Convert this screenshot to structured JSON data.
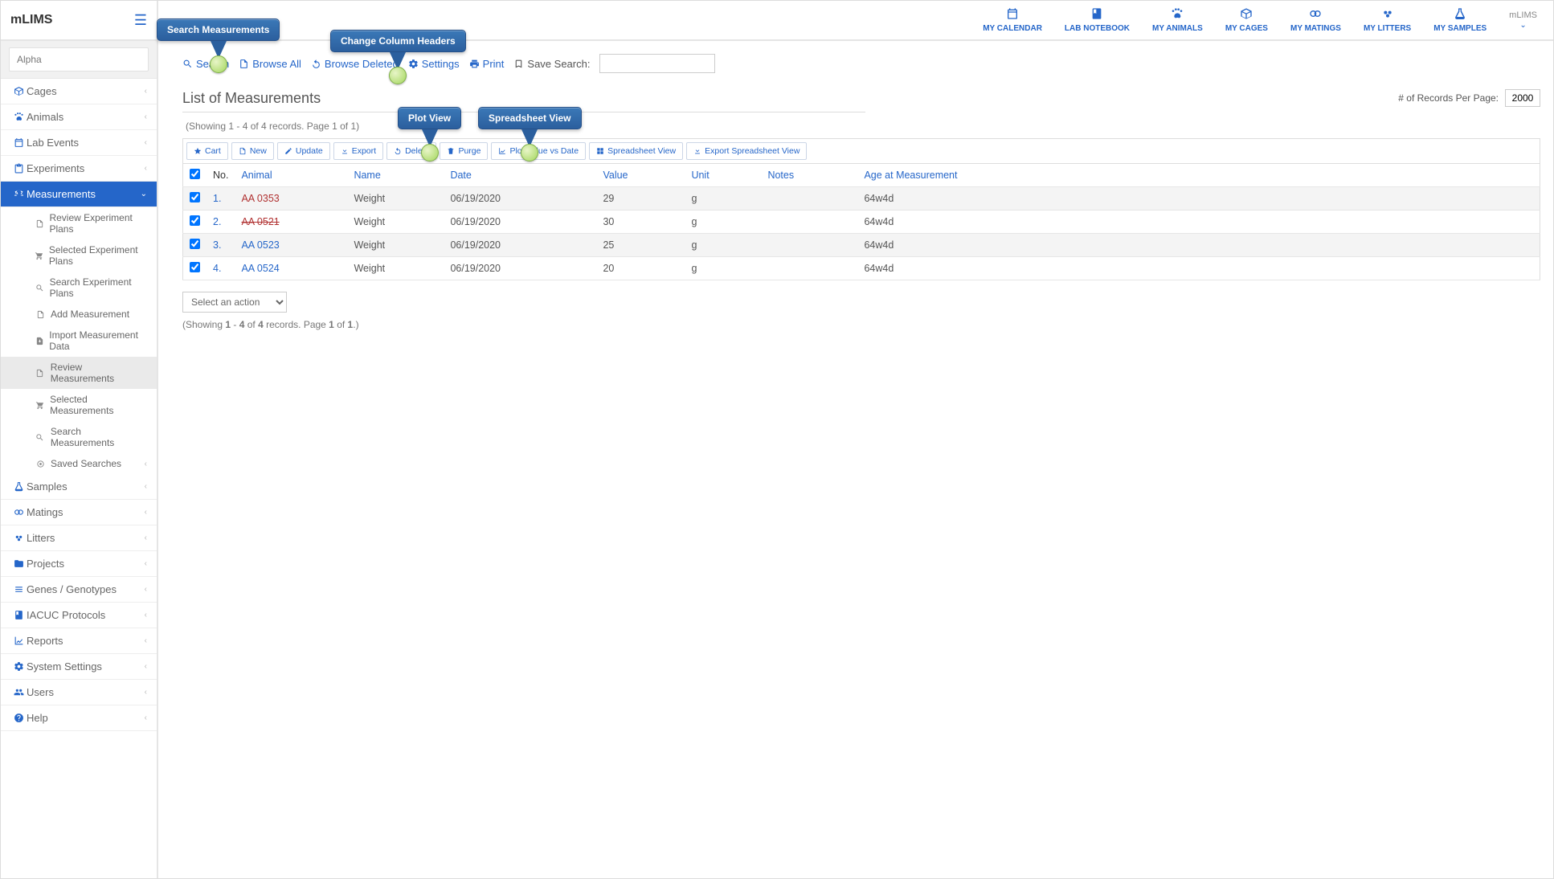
{
  "brand": "mLIMS",
  "search_value": "Alpha",
  "profile_label": "mLIMS",
  "quicknav": [
    {
      "label": "MY CALENDAR",
      "icon": "calendar"
    },
    {
      "label": "LAB NOTEBOOK",
      "icon": "book"
    },
    {
      "label": "MY ANIMALS",
      "icon": "paw"
    },
    {
      "label": "MY CAGES",
      "icon": "cube"
    },
    {
      "label": "MY MATINGS",
      "icon": "matings"
    },
    {
      "label": "MY LITTERS",
      "icon": "litters"
    },
    {
      "label": "MY SAMPLES",
      "icon": "flask"
    }
  ],
  "nav": {
    "items": [
      {
        "label": "Cages",
        "icon": "cube"
      },
      {
        "label": "Animals",
        "icon": "paw"
      },
      {
        "label": "Lab Events",
        "icon": "calendar"
      },
      {
        "label": "Experiments",
        "icon": "clipboard"
      },
      {
        "label": "Measurements",
        "icon": "scale",
        "active": true
      },
      {
        "label": "Samples",
        "icon": "flask"
      },
      {
        "label": "Matings",
        "icon": "matings"
      },
      {
        "label": "Litters",
        "icon": "litters"
      },
      {
        "label": "Projects",
        "icon": "folder"
      },
      {
        "label": "Genes / Genotypes",
        "icon": "list"
      },
      {
        "label": "IACUC Protocols",
        "icon": "book"
      },
      {
        "label": "Reports",
        "icon": "chart"
      },
      {
        "label": "System Settings",
        "icon": "gear"
      },
      {
        "label": "Users",
        "icon": "users"
      },
      {
        "label": "Help",
        "icon": "help"
      }
    ],
    "sub": [
      {
        "label": "Review Experiment Plans",
        "icon": "doc"
      },
      {
        "label": "Selected Experiment Plans",
        "icon": "cart"
      },
      {
        "label": "Search Experiment Plans",
        "icon": "search"
      },
      {
        "label": "Add Measurement",
        "icon": "doc"
      },
      {
        "label": "Import Measurement Data",
        "icon": "import"
      },
      {
        "label": "Review Measurements",
        "icon": "doc",
        "selected": true
      },
      {
        "label": "Selected Measurements",
        "icon": "cart"
      },
      {
        "label": "Search Measurements",
        "icon": "search"
      },
      {
        "label": "Saved Searches",
        "icon": "target",
        "chev": true
      }
    ]
  },
  "toolbar": {
    "search": "Search",
    "browse_all": "Browse All",
    "browse_deleted": "Browse Deleted",
    "settings": "Settings",
    "print": "Print",
    "save_search": "Save Search:"
  },
  "callouts": {
    "search": "Search Measurements",
    "settings": "Change Column Headers",
    "plot": "Plot View",
    "spreadsheet": "Spreadsheet View"
  },
  "page": {
    "title": "List of Measurements",
    "per_page_label": "# of Records Per Page:",
    "per_page_value": "2000",
    "paging_top": "(Showing 1 - 4 of 4 records. Page 1 of 1)",
    "paging_bot_prefix": "(Showing ",
    "paging_bot": {
      "a": "1",
      "b": "4",
      "c": "4",
      "d": "1",
      "e": "1"
    },
    "action_placeholder": "Select an action"
  },
  "buttons": {
    "cart": "Cart",
    "new": "New",
    "update": "Update",
    "export": "Export",
    "delete": "Delete",
    "purge": "Purge",
    "plot": "Plot Value vs Date",
    "spreadsheet": "Spreadsheet View",
    "export_ss": "Export Spreadsheet View"
  },
  "table": {
    "headers": {
      "no": "No.",
      "animal": "Animal",
      "name": "Name",
      "date": "Date",
      "value": "Value",
      "unit": "Unit",
      "notes": "Notes",
      "age": "Age at Measurement"
    },
    "rows": [
      {
        "no": "1.",
        "animal": "AA 0353",
        "cls": "red",
        "name": "Weight",
        "date": "06/19/2020",
        "value": "29",
        "unit": "g",
        "notes": "",
        "age": "64w4d"
      },
      {
        "no": "2.",
        "animal": "AA 0521",
        "cls": "struck",
        "name": "Weight",
        "date": "06/19/2020",
        "value": "30",
        "unit": "g",
        "notes": "",
        "age": "64w4d"
      },
      {
        "no": "3.",
        "animal": "AA 0523",
        "cls": "",
        "name": "Weight",
        "date": "06/19/2020",
        "value": "25",
        "unit": "g",
        "notes": "",
        "age": "64w4d"
      },
      {
        "no": "4.",
        "animal": "AA 0524",
        "cls": "",
        "name": "Weight",
        "date": "06/19/2020",
        "value": "20",
        "unit": "g",
        "notes": "",
        "age": "64w4d"
      }
    ]
  }
}
